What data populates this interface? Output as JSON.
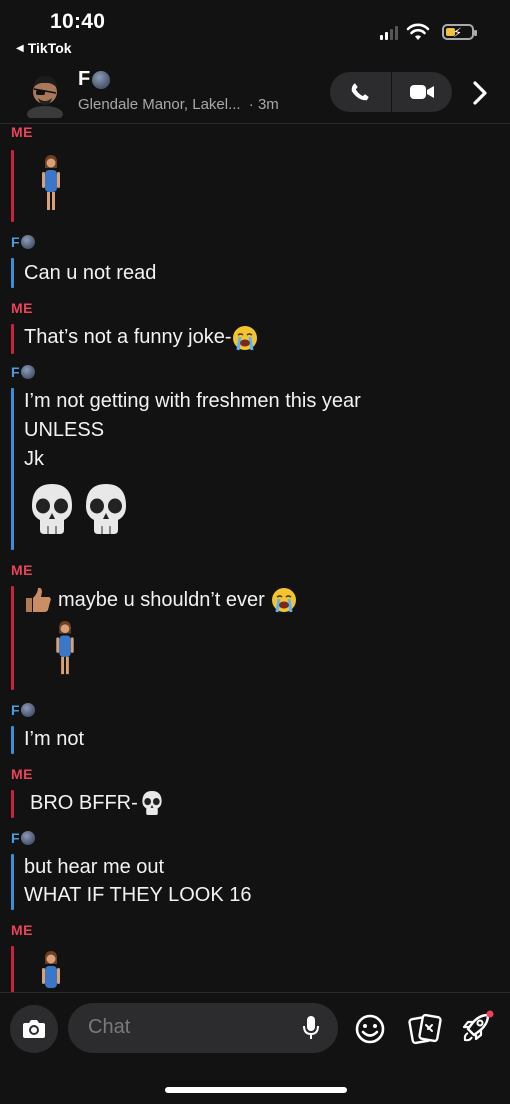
{
  "status_bar": {
    "time": "10:40",
    "back_app": "TikTok"
  },
  "header": {
    "contact_name": "F",
    "location": "Glendale Manor, Lakel...",
    "time_ago": "· 3m"
  },
  "labels": {
    "me": "ME",
    "friend": "F"
  },
  "messages": {
    "m2": "Can u not read",
    "m3": "That’s not a funny joke-",
    "m4_line1": "I’m not getting with freshmen this year",
    "m4_line2": "UNLESS",
    "m4_line3": "Jk",
    "m5": "maybe u shouldn’t ever",
    "m6": "I’m not",
    "m7": "BRO BFFR-",
    "m8_line1": "but hear me out",
    "m8_line2": "WHAT IF THEY LOOK 16"
  },
  "bottom_bar": {
    "chat_placeholder": "Chat"
  },
  "colors": {
    "me": "#e8445a",
    "friend": "#4a9de0",
    "background": "#121212"
  },
  "icons": [
    "back-triangle-icon",
    "signal-icon",
    "wifi-icon",
    "battery-icon",
    "phone-icon",
    "video-icon",
    "chevron-right-icon",
    "moon-emoji-icon",
    "person-emoji-icon",
    "crying-emoji-icon",
    "skull-emoji-icon",
    "thumbs-up-emoji-icon",
    "camera-icon",
    "mic-icon",
    "smiley-icon",
    "cards-icon",
    "rocket-icon"
  ]
}
